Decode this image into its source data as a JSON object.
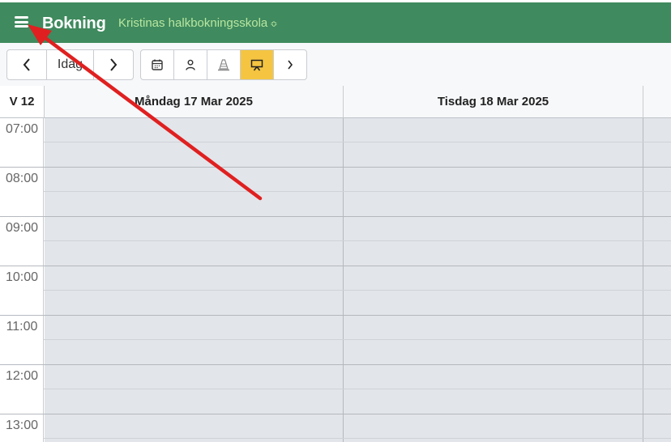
{
  "header": {
    "menu_icon": "hamburger-menu-icon",
    "title": "Bokning",
    "school_name": "Kristinas halkbokningsskola",
    "school_chevron": "≎",
    "bg_color": "#3f8a5e",
    "school_color": "#b8e6a0"
  },
  "toolbar": {
    "prev_icon": "chevron-left-icon",
    "today_label": "Idag",
    "next_icon": "chevron-right-icon",
    "view_icons": [
      "calendar-icon",
      "person-icon",
      "cone-icon",
      "presentation-icon",
      "chevron-right-icon"
    ],
    "active_view": "presentation-icon",
    "active_color": "#f5c542"
  },
  "calendar": {
    "week_label": "V 12",
    "days": [
      "Måndag 17 Mar 2025",
      "Tisdag 18 Mar 2025"
    ],
    "times": [
      "07:00",
      "08:00",
      "09:00",
      "10:00",
      "11:00",
      "12:00",
      "13:00"
    ]
  },
  "annotation": {
    "type": "red-arrow",
    "color": "#e02020",
    "points_to": "hamburger-menu-icon"
  }
}
